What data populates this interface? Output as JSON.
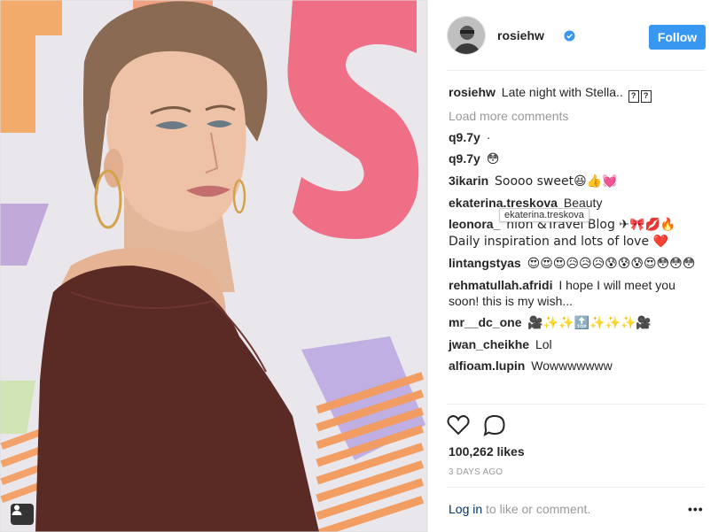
{
  "post": {
    "username": "rosiehw",
    "follow_label": "Follow",
    "caption_user": "rosiehw",
    "caption_text": "Late night with Stella..",
    "caption_marks": [
      "?",
      "?"
    ],
    "load_more": "Load more comments",
    "comments": [
      {
        "user": "q9.7y",
        "text": "·"
      },
      {
        "user": "q9.7y",
        "text": "😳"
      },
      {
        "user": "3ikarin",
        "text": "Soooo sweet😆👍💓"
      },
      {
        "user": "ekaterina.treskova",
        "text": "Beauty"
      },
      {
        "user": "leonora_",
        "text": "hion &Travel Blog ✈🎀💋🔥 Daily inspiration and lots of love ❤️"
      },
      {
        "user": "lintangstyas",
        "text": "😍😍😍😥😥😥😰😰😰😍😳😳😳"
      },
      {
        "user": "rehmatullah.afridi",
        "text": "I hope I will meet you soon! this is my wish..."
      },
      {
        "user": "mr__dc_one",
        "text": "🎥✨✨🔝✨✨✨🎥"
      },
      {
        "user": "jwan_cheikhe",
        "text": "Lol"
      },
      {
        "user": "alfioam.lupin",
        "text": "Wowwwwwww"
      }
    ],
    "tooltip": "ekaterina.treskova",
    "likes": "100,262 likes",
    "time_ago": "3 DAYS AGO",
    "login_link": "Log in",
    "login_rest": " to like or comment.",
    "more_label": "•••"
  },
  "colors": {
    "follow_bg": "#3897f0",
    "verified": "#3897f0",
    "link": "#003569"
  },
  "icons": {
    "like": "heart-outline-icon",
    "comment": "speech-bubble-icon",
    "verified": "verified-badge-icon",
    "tag": "person-tag-icon"
  }
}
